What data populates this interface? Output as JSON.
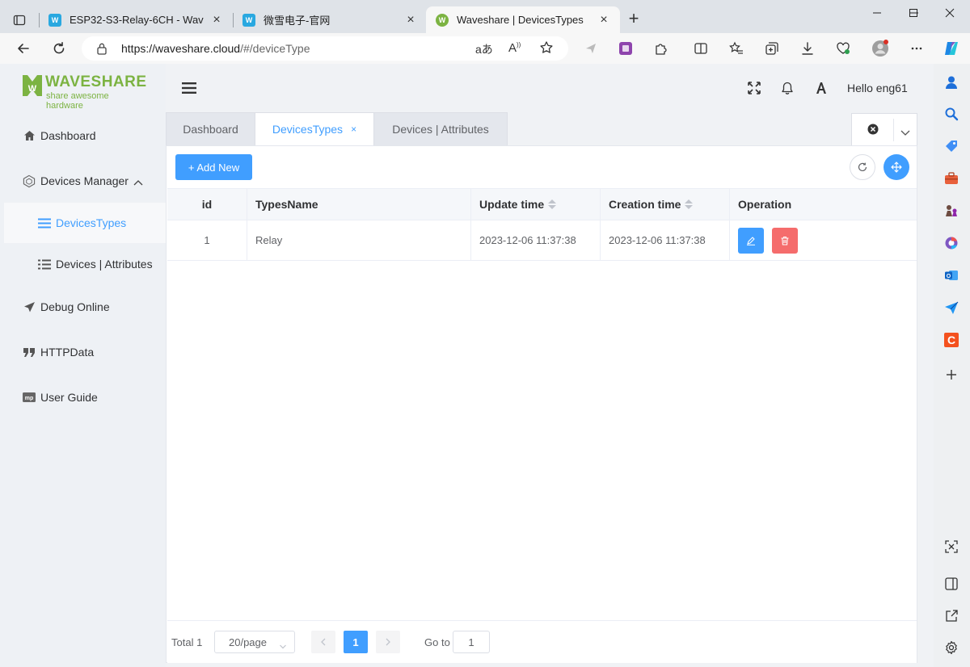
{
  "browser": {
    "tabs": [
      {
        "title": "ESP32-S3-Relay-6CH - Waveshare",
        "active": false
      },
      {
        "title": "微雪电子-官网",
        "active": false
      },
      {
        "title": "Waveshare | DevicesTypes",
        "active": true
      }
    ],
    "url_host": "https://waveshare.cloud",
    "url_path": "/#/deviceType"
  },
  "sidebar": {
    "brand": "WAVESHARE",
    "slogan": "share awesome hardware",
    "items": [
      {
        "label": "Dashboard",
        "icon": "home-icon"
      },
      {
        "label": "Devices Manager",
        "icon": "devices-icon"
      },
      {
        "label": "DevicesTypes",
        "icon": "list-icon"
      },
      {
        "label": "Devices | Attributes",
        "icon": "list-icon"
      },
      {
        "label": "Debug Online",
        "icon": "send-icon"
      },
      {
        "label": "HTTPData",
        "icon": "quote-icon"
      },
      {
        "label": "User Guide",
        "icon": "mp-icon"
      }
    ]
  },
  "header": {
    "greeting": "Hello eng61"
  },
  "tags": [
    {
      "label": "Dashboard"
    },
    {
      "label": "DevicesTypes",
      "close": "×"
    },
    {
      "label": "Devices | Attributes"
    }
  ],
  "toolbar": {
    "add_label": "+ Add New"
  },
  "table": {
    "columns": [
      "id",
      "TypesName",
      "Update time",
      "Creation time",
      "Operation"
    ],
    "rows": [
      {
        "id": "1",
        "name": "Relay",
        "update": "2023-12-06 11:37:38",
        "created": "2023-12-06 11:37:38"
      }
    ]
  },
  "pagination": {
    "total": "Total 1",
    "page_size": "20/page",
    "current": "1",
    "goto_label": "Go to",
    "goto_value": "1"
  },
  "colors": {
    "primary": "#409eff",
    "danger": "#f56c6c",
    "brand_green": "#7cb342"
  }
}
